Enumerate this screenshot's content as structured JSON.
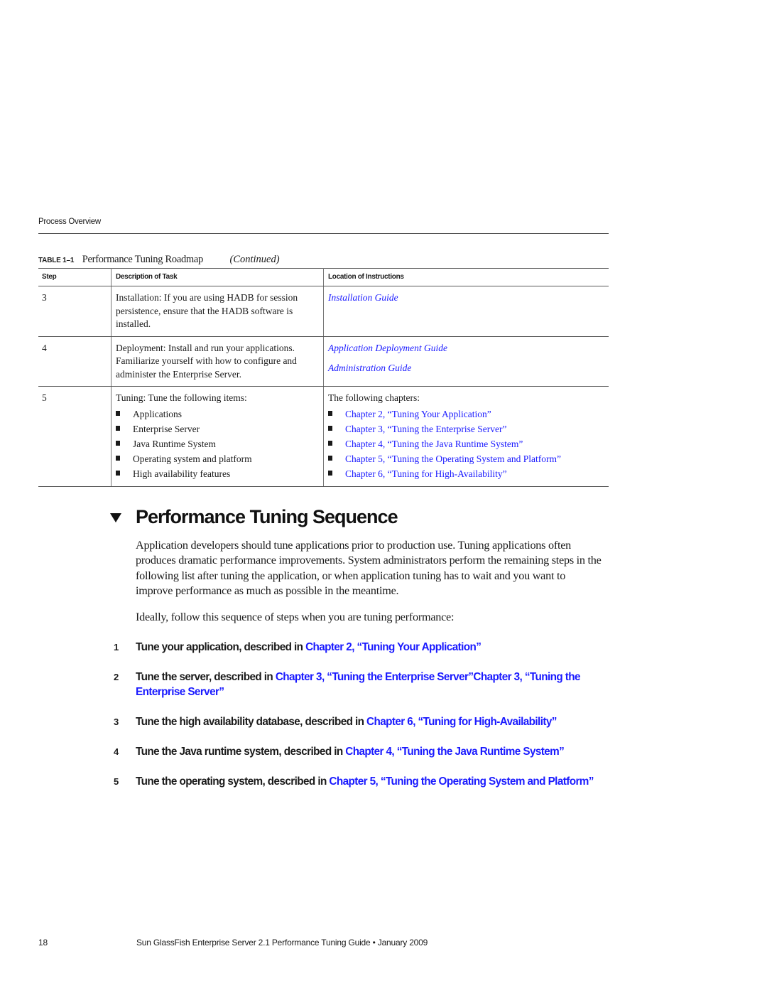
{
  "running_head": "Process Overview",
  "table": {
    "label": "TABLE 1–1",
    "title": "Performance Tuning Roadmap",
    "continued": "(Continued)",
    "headers": [
      "Step",
      "Description of Task",
      "Location of Instructions"
    ],
    "rows": [
      {
        "step": "3",
        "description": "Installation: If you are using HADB for session persistence, ensure that the HADB software is installed.",
        "links": [
          "Installation Guide"
        ]
      },
      {
        "step": "4",
        "description": "Deployment: Install and run your applications. Familiarize yourself with how to configure and administer the Enterprise Server.",
        "links": [
          "Application Deployment Guide",
          "Administration Guide"
        ]
      },
      {
        "step": "5",
        "description": "Tuning: Tune the following items:",
        "items": [
          "Applications",
          "Enterprise Server",
          "Java Runtime System",
          "Operating system and platform",
          "High availability features"
        ],
        "location_intro": "The following chapters:",
        "chapter_links": [
          "Chapter 2, “Tuning Your Application”",
          "Chapter 3, “Tuning the Enterprise Server”",
          "Chapter 4, “Tuning the Java Runtime System”",
          "Chapter 5, “Tuning the Operating System and Platform”",
          "Chapter 6, “Tuning for High-Availability”"
        ]
      }
    ]
  },
  "section": {
    "title": "Performance Tuning Sequence",
    "paragraph1": "Application developers should tune applications prior to production use. Tuning applications often produces dramatic performance improvements. System administrators perform the remaining steps in the following list after tuning the application, or when application tuning has to wait and you want to improve performance as much as possible in the meantime.",
    "paragraph2": "Ideally, follow this sequence of steps when you are tuning performance:",
    "steps": [
      {
        "num": "1",
        "text": "Tune your application, described in ",
        "link": "Chapter 2, “Tuning Your Application”"
      },
      {
        "num": "2",
        "text": "Tune the server, described in ",
        "link": "Chapter 3, “Tuning the Enterprise Server”Chapter 3, “Tuning the Enterprise Server”"
      },
      {
        "num": "3",
        "text": "Tune the high availability database, described in ",
        "link": "Chapter 6, “Tuning for High-Availability”"
      },
      {
        "num": "4",
        "text": "Tune the Java runtime system, described in ",
        "link": "Chapter 4, “Tuning the Java Runtime System”"
      },
      {
        "num": "5",
        "text": "Tune the operating system, described in ",
        "link": "Chapter 5, “Tuning the Operating System and Platform”"
      }
    ]
  },
  "footer": {
    "page_number": "18",
    "title": "Sun GlassFish Enterprise Server 2.1 Performance Tuning Guide  •  January 2009"
  },
  "colors": {
    "link": "#1a1aff",
    "text": "#1a1a1a"
  }
}
